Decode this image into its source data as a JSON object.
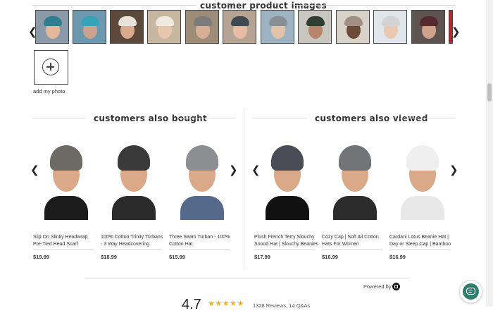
{
  "customer_images": {
    "title": "customer product images",
    "thumbnails": [
      {
        "bg": "#8a9aa8",
        "face": "#e2b79a",
        "hat": "#2d7f8f"
      },
      {
        "bg": "#6c98b0",
        "face": "#c9a38d",
        "hat": "#35a3b8"
      },
      {
        "bg": "#5b4a3c",
        "face": "#dba98d",
        "hat": "#e8e2d8"
      },
      {
        "bg": "#c8b7a0",
        "face": "#e7c6ad",
        "hat": "#efe9df"
      },
      {
        "bg": "#9c8c78",
        "face": "#d8ae96",
        "hat": "#7b7b7b"
      },
      {
        "bg": "#b5a494",
        "face": "#e7bca2",
        "hat": "#3e4950"
      },
      {
        "bg": "#9eb3c2",
        "face": "#e3c2ab",
        "hat": "#8a8f96"
      },
      {
        "bg": "#c9c5bf",
        "face": "#b7866a",
        "hat": "#2f3d33"
      },
      {
        "bg": "#d7d1c8",
        "face": "#6b4a3a",
        "hat": "#a18f84"
      },
      {
        "bg": "#dfe5ea",
        "face": "#e9c7b0",
        "hat": "#d3d3d3"
      },
      {
        "bg": "#5d5452",
        "face": "#d1a28b",
        "hat": "#542a2d"
      },
      {
        "bg": "#b1272e",
        "face": "#b1272e",
        "hat": "#b1272e"
      }
    ],
    "add_photo_label": "add my photo"
  },
  "also_bought": {
    "title": "customers also bought",
    "products": [
      {
        "name": "Slip On Slinky Headwrap Pre-Tied Head Scarf",
        "price": "$19.99",
        "cap": "#6d6a63",
        "bust": "#1b1b1b"
      },
      {
        "name": "100% Cotton Trinity Turbans - 3 Way Headcovering",
        "price": "$18.99",
        "cap": "#3a3a3a",
        "bust": "#2b2b2b"
      },
      {
        "name": "Three Seam Turban - 100% Cotton Hat",
        "price": "$15.99",
        "cap": "#8c8e92",
        "bust": "#55698a"
      }
    ]
  },
  "also_viewed": {
    "title": "customers also viewed",
    "products": [
      {
        "name": "Plush French Terry Slouchy Snood Hat | Slouchy Beanies",
        "price": "$17.99",
        "cap": "#4a4d55",
        "bust": "#111111"
      },
      {
        "name": "Cozy Cap | Soft All Cotton Hats For Women",
        "price": "$16.99",
        "cap": "#727478",
        "bust": "#2c2c2c"
      },
      {
        "name": "Cardani Lotus Beanie Hat | Day or Sleep Cap | Bamboo",
        "price": "$16.99",
        "cap": "#efefef",
        "bust": "#e8e8e8"
      }
    ]
  },
  "footer": {
    "powered_by": "Powered by",
    "rating_value": "4.7",
    "rating_stars": 4.7,
    "star_color": "#f2b01e",
    "reviews_text": "1328 Reviews, 14 Q&As"
  },
  "colors": {
    "accent_chat": "#2f7d6b"
  }
}
